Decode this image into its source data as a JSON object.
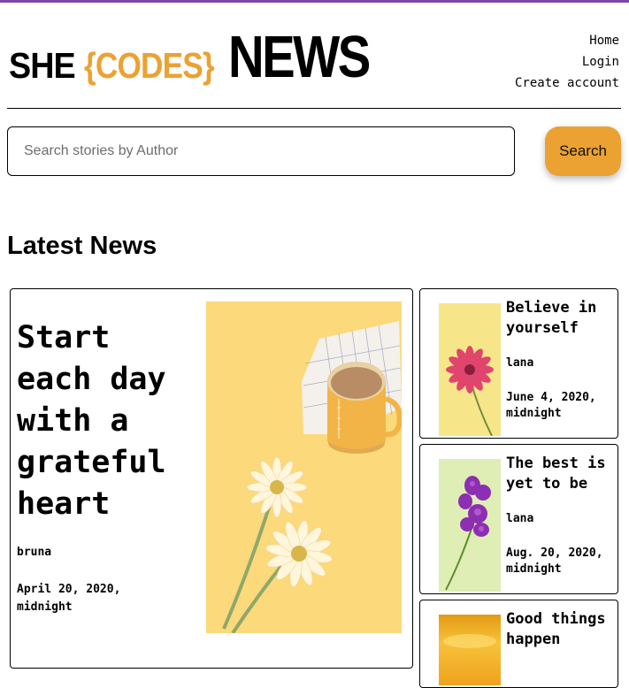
{
  "brand": {
    "she": "SHE",
    "codes": "{CODES}",
    "news": "NEWS",
    "accent": "#eba233",
    "top_bar": "#7a4aa6"
  },
  "nav": {
    "items": [
      "Home",
      "Login",
      "Create account"
    ]
  },
  "search": {
    "placeholder": "Search stories by Author",
    "value": "",
    "button_label": "Search"
  },
  "section": {
    "title": "Latest News"
  },
  "stories": [
    {
      "title": "Start each day with a grateful heart",
      "author": "bruna",
      "date": "April 20, 2020, midnight",
      "image": "coffee-and-daisies-photo"
    },
    {
      "title": "Believe in yourself",
      "author": "lana",
      "date": "June 4, 2020, midnight",
      "image": "pink-daisy-photo"
    },
    {
      "title": "The best is yet to be",
      "author": "lana",
      "date": "Aug. 20, 2020, midnight",
      "image": "purple-orchid-photo"
    },
    {
      "title": "Good things happen",
      "author": "",
      "date": "",
      "image": "golden-sunset-photo"
    }
  ]
}
